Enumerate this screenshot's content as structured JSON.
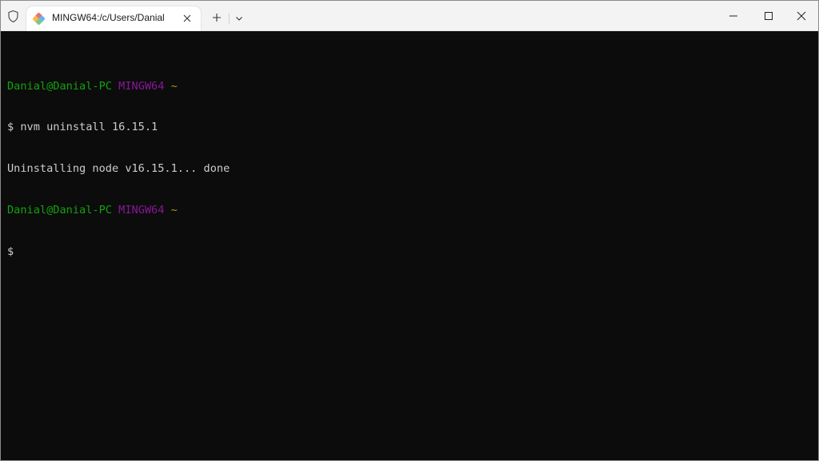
{
  "tab": {
    "title": "MINGW64:/c/Users/Danial"
  },
  "icons": {
    "shield": "shield-icon",
    "tab_icon": "git-bash-icon",
    "tab_close": "close-icon",
    "new_tab": "plus-icon",
    "dropdown": "chevron-down-icon",
    "minimize": "minimize-icon",
    "maximize": "maximize-icon",
    "close": "close-icon"
  },
  "terminal": {
    "prompt1": {
      "user_host": "Danial@Danial-PC",
      "shell": "MINGW64",
      "path": "~"
    },
    "command": "$ nvm uninstall 16.15.1",
    "output": "Uninstalling node v16.15.1... done",
    "prompt2": {
      "user_host": "Danial@Danial-PC",
      "shell": "MINGW64",
      "path": "~"
    },
    "cursor_line": "$"
  },
  "colors": {
    "background": "#0c0c0c",
    "prompt_user": "#13a10e",
    "prompt_shell": "#881798",
    "prompt_path": "#c19c00",
    "text": "#cccccc"
  }
}
